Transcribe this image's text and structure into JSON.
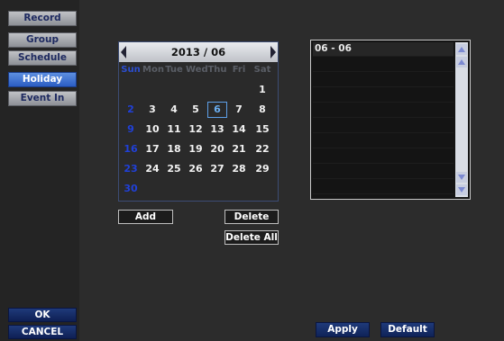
{
  "sidebar": {
    "items": [
      {
        "label": "Record"
      },
      {
        "label": "Group"
      },
      {
        "label": "Schedule"
      },
      {
        "label": "Holiday"
      },
      {
        "label": "Event In"
      }
    ],
    "ok_label": "OK",
    "cancel_label": "CANCEL"
  },
  "calendar": {
    "month_label": "2013 / 06",
    "weekdays": [
      "Sun",
      "Mon",
      "Tue",
      "Wed",
      "Thu",
      "Fri",
      "Sat"
    ],
    "weeks": [
      [
        "",
        "",
        "",
        "",
        "",
        "",
        "1"
      ],
      [
        "2",
        "3",
        "4",
        "5",
        "6",
        "7",
        "8"
      ],
      [
        "9",
        "10",
        "11",
        "12",
        "13",
        "14",
        "15"
      ],
      [
        "16",
        "17",
        "18",
        "19",
        "20",
        "21",
        "22"
      ],
      [
        "23",
        "24",
        "25",
        "26",
        "27",
        "28",
        "29"
      ],
      [
        "30",
        "",
        "",
        "",
        "",
        "",
        ""
      ]
    ],
    "selected_day": "6"
  },
  "actions": {
    "add_label": "Add",
    "delete_label": "Delete",
    "delete_all_label": "Delete All"
  },
  "holiday_list": {
    "items": [
      "06 - 06"
    ]
  },
  "footer": {
    "apply_label": "Apply",
    "default_label": "Default"
  },
  "colors": {
    "active_tab": "#2b5dc3",
    "sunday": "#2040d8",
    "selected_day": "#6aaef0"
  }
}
